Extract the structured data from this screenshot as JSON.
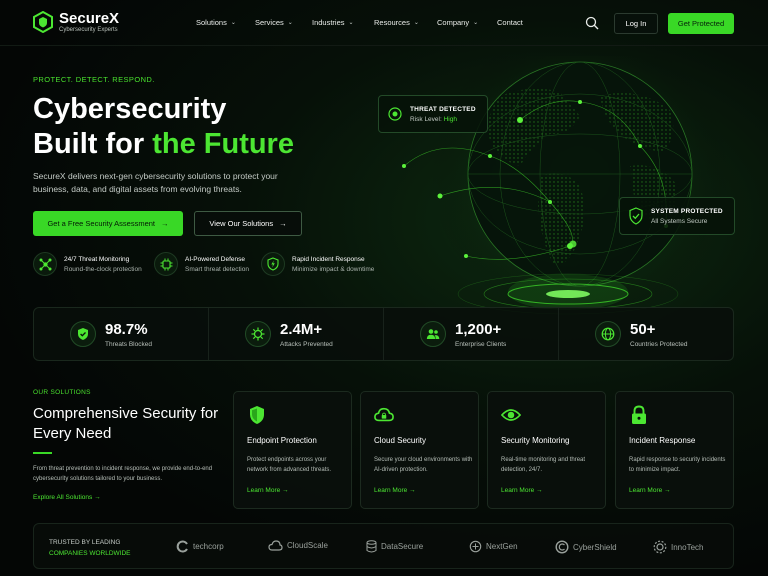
{
  "brand": {
    "name": "SecureX",
    "tagline": "Cybersecurity Experts"
  },
  "nav": [
    {
      "label": "Solutions",
      "has_dropdown": true
    },
    {
      "label": "Services",
      "has_dropdown": true
    },
    {
      "label": "Industries",
      "has_dropdown": true
    },
    {
      "label": "Resources",
      "has_dropdown": true
    },
    {
      "label": "Company",
      "has_dropdown": true
    },
    {
      "label": "Contact",
      "has_dropdown": false
    }
  ],
  "header": {
    "login_label": "Log In",
    "cta_label": "Get Protected",
    "search_icon": "search-icon"
  },
  "hero": {
    "eyebrow": "PROTECT. DETECT. RESPOND.",
    "title_line1": "Cybersecurity",
    "title_line2_plain": "Built for ",
    "title_line2_accent": "the Future",
    "description": "SecureX delivers next-gen cybersecurity solutions to protect your business, data, and digital assets from evolving threats.",
    "primary_button": "Get a Free Security Assessment",
    "secondary_button": "View Our Solutions"
  },
  "features": [
    {
      "title": "24/7 Threat Monitoring",
      "subtitle": "Round-the-clock protection",
      "icon": "network-icon"
    },
    {
      "title": "AI-Powered Defense",
      "subtitle": "Smart threat detection",
      "icon": "ai-chip-icon"
    },
    {
      "title": "Rapid Incident Response",
      "subtitle": "Minimize impact & downtime",
      "icon": "shield-bolt-icon"
    }
  ],
  "globe_cards": {
    "threat": {
      "title": "THREAT DETECTED",
      "risk_label": "Risk Level: ",
      "risk_value": "High"
    },
    "system": {
      "title": "SYSTEM PROTECTED",
      "subtitle": "All Systems Secure"
    }
  },
  "stats": [
    {
      "value": "98.7%",
      "label": "Threats Blocked",
      "icon": "shield-check-icon"
    },
    {
      "value": "2.4M+",
      "label": "Attacks Prevented",
      "icon": "virus-icon"
    },
    {
      "value": "1,200+",
      "label": "Enterprise Clients",
      "icon": "users-icon"
    },
    {
      "value": "50+",
      "label": "Countries Protected",
      "icon": "globe-icon"
    }
  ],
  "solutions": {
    "eyebrow": "OUR SOLUTIONS",
    "title": "Comprehensive Security for Every Need",
    "description": "From threat prevention to incident response, we provide end-to-end cybersecurity solutions tailored to your business.",
    "link": "Explore All Solutions",
    "cards": [
      {
        "title": "Endpoint Protection",
        "description": "Protect endpoints across your network from advanced threats.",
        "link": "Learn More",
        "icon": "shield-icon"
      },
      {
        "title": "Cloud Security",
        "description": "Secure your cloud environments with AI-driven protection.",
        "link": "Learn More",
        "icon": "cloud-lock-icon"
      },
      {
        "title": "Security Monitoring",
        "description": "Real-time monitoring and threat detection, 24/7.",
        "link": "Learn More",
        "icon": "eye-icon"
      },
      {
        "title": "Incident Response",
        "description": "Rapid response to security incidents to minimize impact.",
        "link": "Learn More",
        "icon": "lock-icon"
      }
    ]
  },
  "trusted": {
    "label_line1": "TRUSTED BY LEADING",
    "label_line2": "COMPANIES WORLDWIDE",
    "logos": [
      "techcorp",
      "CloudScale",
      "DataSecure",
      "NextGen",
      "CyberShield",
      "InnoTech"
    ]
  },
  "colors": {
    "accent": "#39d826",
    "accent_text": "#4ce632",
    "background": "#050806"
  }
}
